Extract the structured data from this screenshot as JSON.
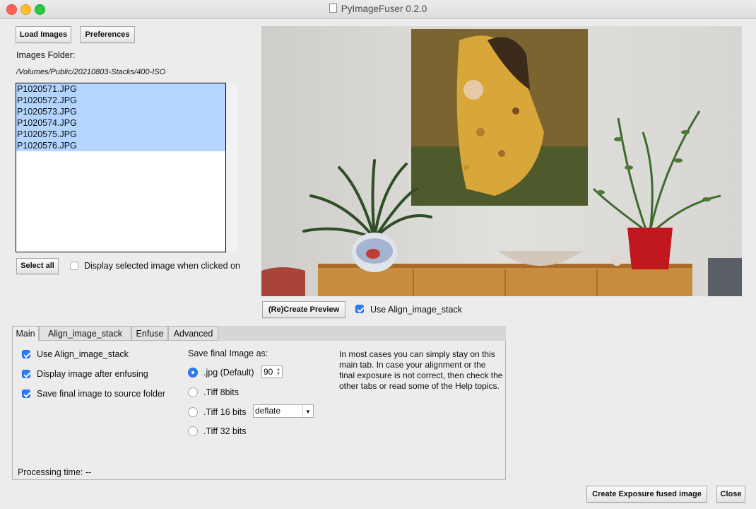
{
  "window": {
    "title": "PyImageFuser 0.2.0"
  },
  "toolbar": {
    "load_images": "Load Images",
    "preferences": "Preferences"
  },
  "folder": {
    "label": "Images Folder:",
    "path": "/Volumes/Public/20210803-Stacks/400-ISO"
  },
  "files": [
    "P1020571.JPG",
    "P1020572.JPG",
    "P1020573.JPG",
    "P1020574.JPG",
    "P1020575.JPG",
    "P1020576.JPG"
  ],
  "list_controls": {
    "select_all": "Select all",
    "display_selected": "Display selected image when clicked on",
    "display_selected_checked": false
  },
  "preview": {
    "create_button": "(Re)Create Preview",
    "use_align": "Use Align_image_stack",
    "use_align_checked": true
  },
  "tabs": [
    "Main",
    "Align_image_stack",
    "Enfuse",
    "Advanced"
  ],
  "active_tab": "Main",
  "main_tab": {
    "use_align": "Use Align_image_stack",
    "display_after": "Display image after enfusing",
    "save_source": "Save final image to source folder",
    "save_as_label": "Save final Image as:",
    "format_jpg": ".jpg (Default)",
    "jpg_quality": "90",
    "format_tiff8": ".Tiff 8bits",
    "format_tiff16": ".Tiff 16 bits",
    "tiff_compression": "deflate",
    "format_tiff32": ".Tiff 32 bits",
    "selected_format": ".jpg (Default)",
    "help_text": "In most cases you can simply stay on this main tab. In case your alignment or the final exposure is not correct, then check the other tabs or read some of the Help topics.",
    "processing_time": "Processing time: --"
  },
  "footer": {
    "create_fused": "Create Exposure fused image",
    "close": "Close"
  },
  "colors": {
    "selection": "#b3d5ff",
    "accent": "#2a7cf7"
  }
}
